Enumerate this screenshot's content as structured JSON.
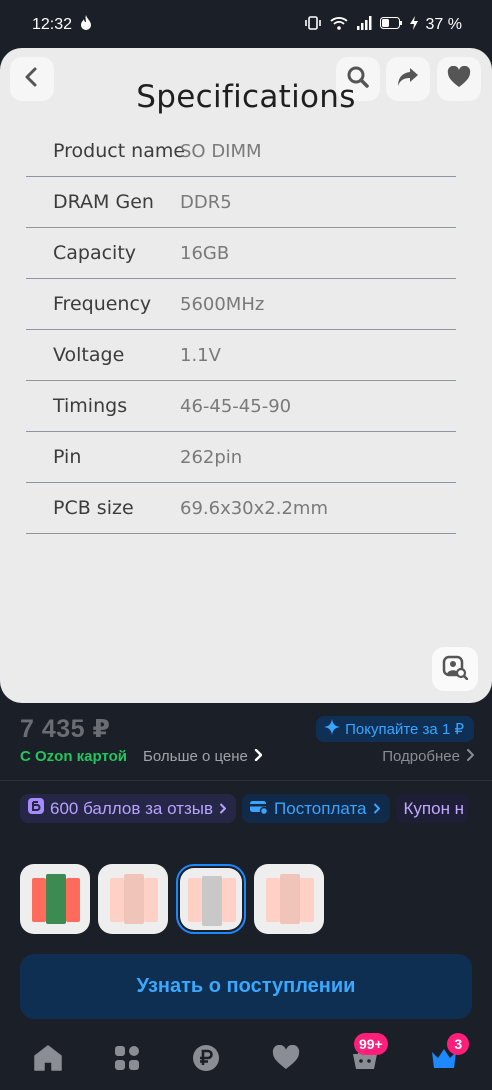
{
  "status_bar": {
    "time": "12:32",
    "battery": "37 %"
  },
  "image_card": {
    "title": "Specifications",
    "specs": [
      {
        "label": "Product name",
        "value": "SO DIMM"
      },
      {
        "label": "DRAM Gen",
        "value": "DDR5"
      },
      {
        "label": "Capacity",
        "value": "16GB"
      },
      {
        "label": "Frequency",
        "value": "5600MHz"
      },
      {
        "label": "Voltage",
        "value": "1.1V"
      },
      {
        "label": "Timings",
        "value": "46-45-45-90"
      },
      {
        "label": "Pin",
        "value": "262pin"
      },
      {
        "label": "PCB size",
        "value": "69.6x30x2.2mm"
      }
    ]
  },
  "price": {
    "value": "7 435 ₽",
    "promo": "Покупайте за 1 ₽",
    "ozon_card": "С Ozon картой",
    "more_price": "Больше о цене",
    "details": "Подробнее"
  },
  "chips": {
    "reviews": "600 баллов за отзыв",
    "postpay": "Постоплата",
    "coupon": "Купон н"
  },
  "notify_button": "Узнать о поступлении",
  "nav": {
    "cart_badge": "99+",
    "profile_badge": "3"
  },
  "colors": {
    "accent_blue": "#3aa8ff",
    "badge_pink": "#ff1f7a",
    "ozon_green": "#22c55e"
  }
}
